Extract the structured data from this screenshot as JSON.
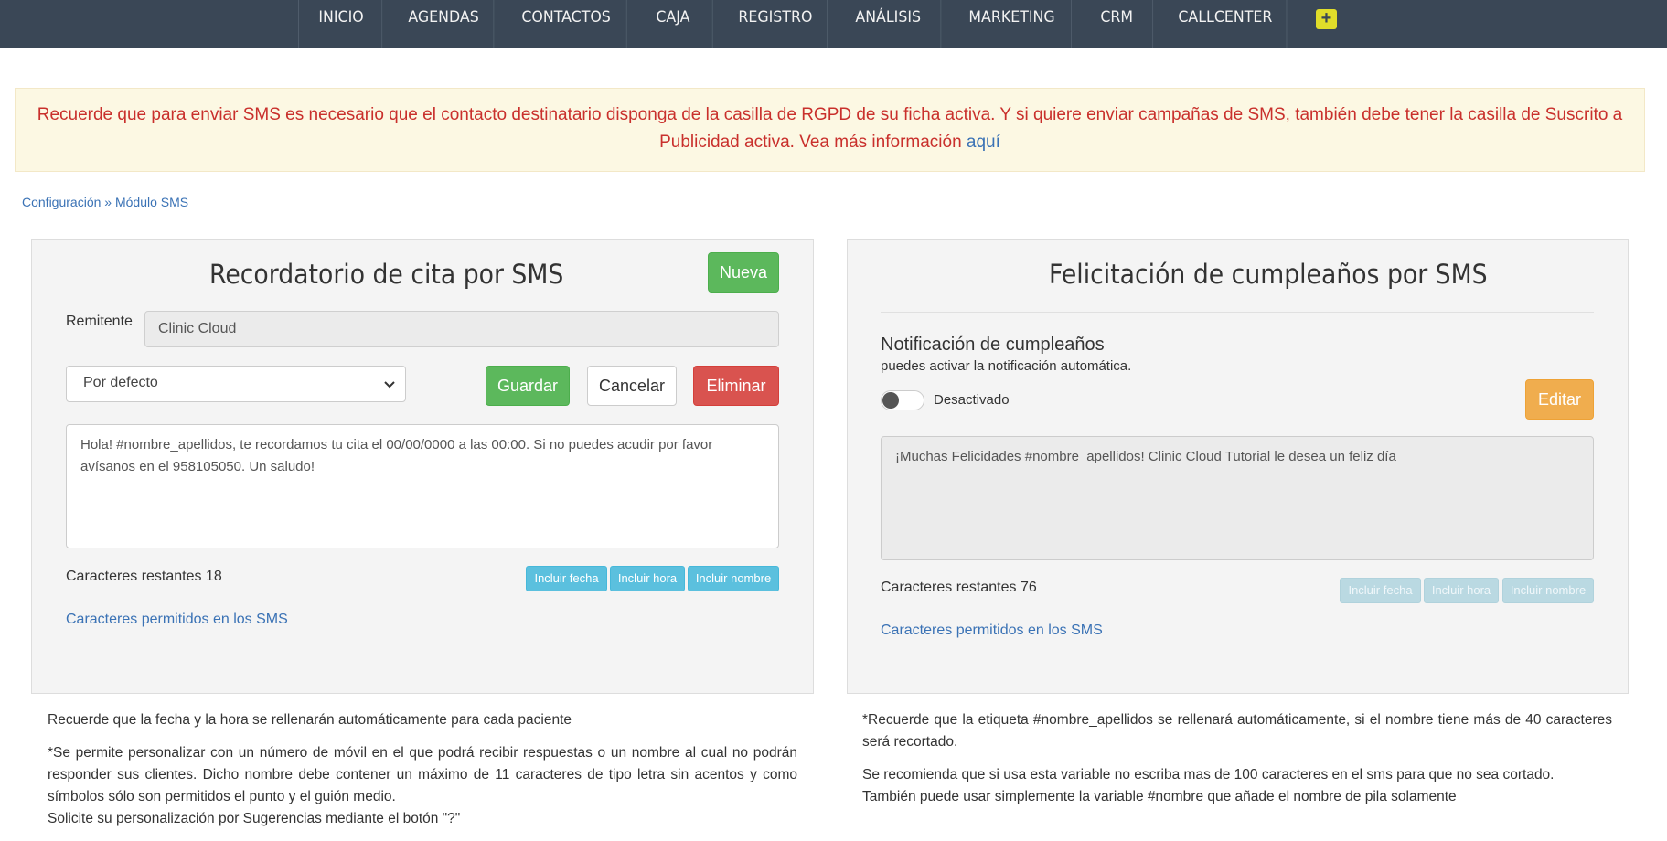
{
  "nav": {
    "items": [
      "INICIO",
      "AGENDAS",
      "CONTACTOS",
      "CAJA",
      "REGISTRO",
      "ANÁLISIS",
      "MARKETING",
      "CRM",
      "CALLCENTER"
    ],
    "plus_icon": "+"
  },
  "alert": {
    "text": "Recuerde que para enviar SMS es necesario que el contacto destinatario disponga de la casilla de RGPD de su ficha activa. Y si quiere enviar campañas de SMS, también debe tener la casilla de Suscrito a Publicidad activa. Vea más información",
    "link": "aquí"
  },
  "breadcrumb": {
    "config": "Configuración",
    "separator": "»",
    "current": "Módulo SMS"
  },
  "reminder": {
    "title": "Recordatorio de cita por SMS",
    "new_button": "Nueva",
    "sender_label": "Remitente",
    "sender_value": "Clinic Cloud",
    "template_select": "Por defecto",
    "save_button": "Guardar",
    "cancel_button": "Cancelar",
    "delete_button": "Eliminar",
    "message": "Hola! #nombre_apellidos, te recordamos tu cita el 00/00/0000 a las 00:00. Si no puedes acudir por favor avísanos en el 958105050. Un saludo!",
    "remaining": "Caracteres restantes 18",
    "include_date": "Incluir fecha",
    "include_time": "Incluir hora",
    "include_name": "Incluir nombre",
    "allowed_link": "Caracteres permitidos en los SMS"
  },
  "birthday": {
    "title": "Felicitación de cumpleaños por SMS",
    "notif_title": "Notificación de cumpleaños",
    "notif_sub": "puedes activar la notificación automática.",
    "toggle_label": "Desactivado",
    "toggle_on": false,
    "edit_button": "Editar",
    "message": "¡Muchas Felicidades #nombre_apellidos! Clinic Cloud Tutorial le desea un feliz día",
    "remaining": "Caracteres restantes 76",
    "include_date": "Incluir fecha",
    "include_time": "Incluir hora",
    "include_name": "Incluir nombre",
    "allowed_link": "Caracteres permitidos en los SMS"
  },
  "notes_left": {
    "p1": "Recuerde que la fecha y la hora se rellenarán automáticamente para cada paciente",
    "p2": "*Se permite personalizar con un número de móvil en el que podrá recibir respuestas o un nombre al cual no podrán responder sus clientes. Dicho nombre debe contener un máximo de 11 caracteres de tipo letra sin acentos y como símbolos sólo son permitidos el punto y el guión medio.",
    "p3": "Solicite su personalización por Sugerencias mediante el botón \"?\""
  },
  "notes_right": {
    "p1": "*Recuerde que la etiqueta #nombre_apellidos se rellenará automáticamente, si el nombre tiene más de 40 caracteres será recortado.",
    "p2": "Se recomienda que si usa esta variable no escriba mas de 100 caracteres en el sms para que no sea cortado.",
    "p3": "También puede usar simplemente la variable #nombre que añade el nombre de pila solamente"
  }
}
